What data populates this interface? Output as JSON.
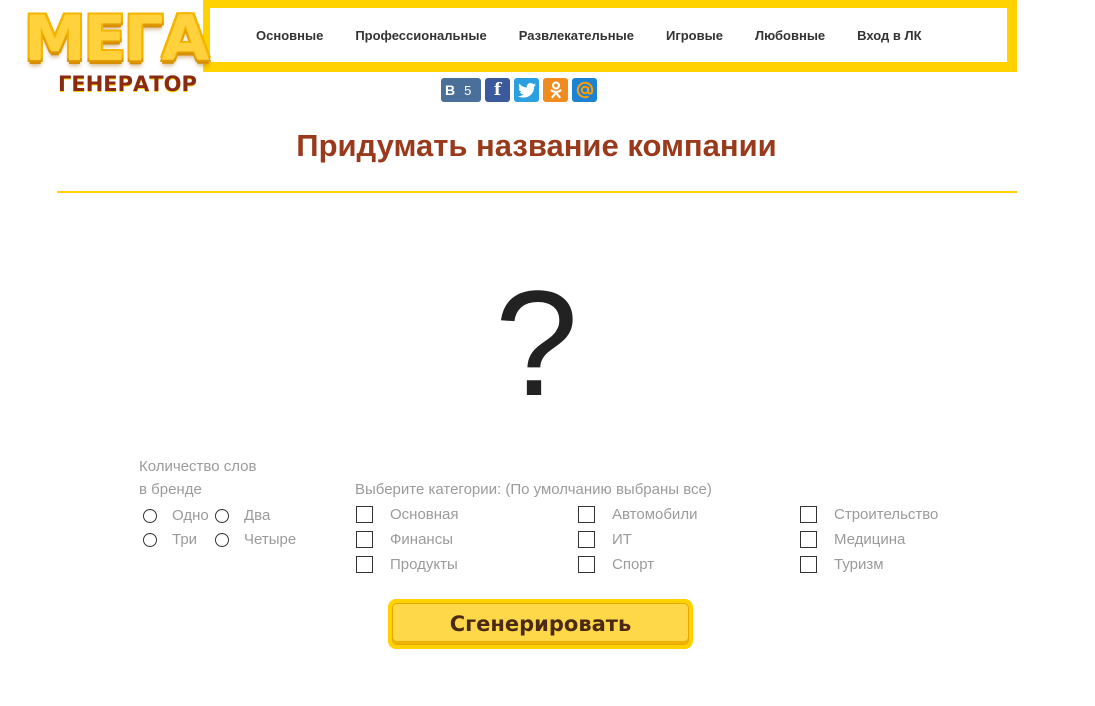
{
  "logo": {
    "top": "МЕГА",
    "bottom": "ГЕНЕРАТОР"
  },
  "nav": {
    "items": [
      {
        "label": "Основные"
      },
      {
        "label": "Профессиональные"
      },
      {
        "label": "Развлекательные"
      },
      {
        "label": "Игровые"
      },
      {
        "label": "Любовные"
      },
      {
        "label": "Вход в ЛК"
      }
    ]
  },
  "social": {
    "vk_label": "В",
    "vk_count": "5",
    "fb_label": "f",
    "icons": [
      "vk-icon",
      "facebook-icon",
      "twitter-icon",
      "odnoklassniki-icon",
      "mailru-icon"
    ],
    "colors": {
      "vk": "#4a6f99",
      "facebook": "#3b5a9b",
      "twitter": "#2b9fe0",
      "odnoklassniki": "#f08b1f",
      "mailru": "#1e82d2"
    }
  },
  "page": {
    "title": "Придумать название компании",
    "result": "?"
  },
  "words": {
    "label_line1": "Количество слов",
    "label_line2": "в бренде",
    "options": [
      {
        "label": "Одно"
      },
      {
        "label": "Два"
      },
      {
        "label": "Три"
      },
      {
        "label": "Четыре"
      }
    ]
  },
  "categories": {
    "label": "Выберите категории: (По умолчанию выбраны все)",
    "items": [
      {
        "label": "Основная"
      },
      {
        "label": "Автомобили"
      },
      {
        "label": "Строительство"
      },
      {
        "label": "Финансы"
      },
      {
        "label": "ИТ"
      },
      {
        "label": "Медицина"
      },
      {
        "label": "Продукты"
      },
      {
        "label": "Спорт"
      },
      {
        "label": "Туризм"
      }
    ]
  },
  "actions": {
    "generate_label": "Сгенерировать"
  },
  "theme": {
    "accent": "#ffd200",
    "title_color": "#9a3a1c",
    "muted_text": "#9b9b9b"
  }
}
